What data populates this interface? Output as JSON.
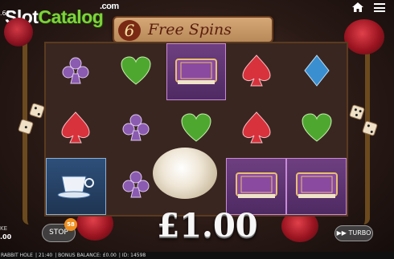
{
  "watermark": {
    "slot": "Slot",
    "catalog": "Catalog",
    "com": ".com"
  },
  "header": {
    "left_text": ".60",
    "home_icon": "home-icon",
    "menu_icon": "hamburger-menu-icon"
  },
  "banner": {
    "count": "6",
    "label": "Free Spins"
  },
  "reels": [
    [
      "purple-club",
      "red-spade",
      "blue-teacup"
    ],
    [
      "green-heart",
      "purple-club",
      "purple-club"
    ],
    [
      "purple-book",
      "green-heart",
      "white-rose-wild"
    ],
    [
      "red-spade",
      "red-spade",
      "purple-book"
    ],
    [
      "blue-diamond",
      "green-heart",
      "purple-book"
    ]
  ],
  "win": {
    "amount": "£1.00"
  },
  "controls": {
    "stop_label": "STOP",
    "spins_badge": "58",
    "turbo_label": "TURBO",
    "stake_label": "KE",
    "stake_value": ".00"
  },
  "statusbar": {
    "game": "RABBIT HOLE",
    "time": "21:40",
    "bonus": "BONUS BALANCE: £0.00",
    "id": "ID: 14598"
  },
  "colors": {
    "club": "#8a5bb0",
    "spade": "#d8323c",
    "heart": "#4ea830",
    "diamond": "#3a8fd0",
    "book": "#6e3f80",
    "cup": "#2e4f7a"
  }
}
